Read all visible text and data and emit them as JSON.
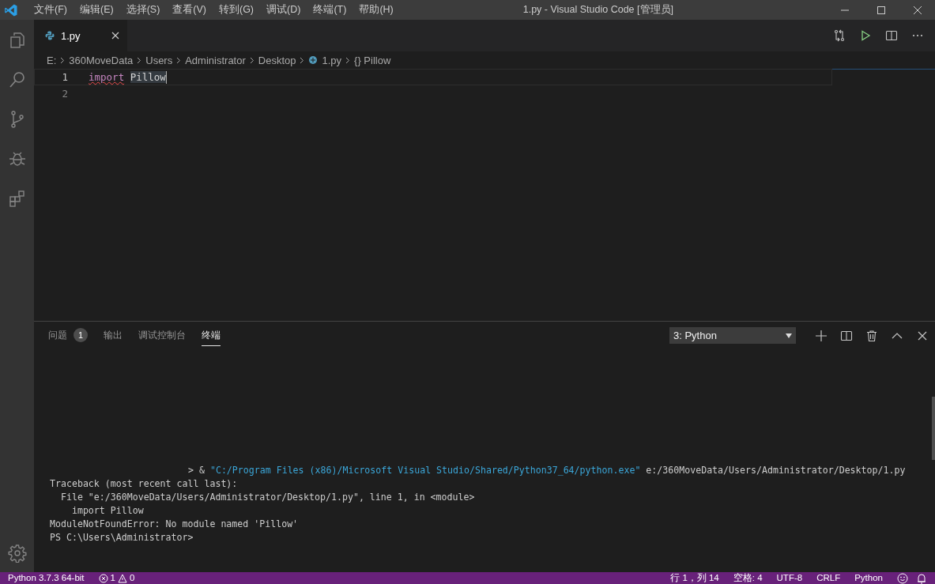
{
  "window": {
    "title": "1.py - Visual Studio Code [管理员]"
  },
  "menu": [
    "文件(F)",
    "编辑(E)",
    "选择(S)",
    "查看(V)",
    "转到(G)",
    "调试(D)",
    "终端(T)",
    "帮助(H)"
  ],
  "activity_bar": [
    {
      "kind": "files"
    },
    {
      "kind": "search"
    },
    {
      "kind": "source-control"
    },
    {
      "kind": "debug"
    },
    {
      "kind": "extensions"
    }
  ],
  "tabs": [
    {
      "label": "1.py",
      "selected": true
    }
  ],
  "breadcrumb": [
    {
      "label": "E:",
      "kind": "folder"
    },
    {
      "label": "360MoveData",
      "kind": "folder"
    },
    {
      "label": "Users",
      "kind": "folder"
    },
    {
      "label": "Administrator",
      "kind": "folder"
    },
    {
      "label": "Desktop",
      "kind": "folder"
    },
    {
      "label": "1.py",
      "kind": "file"
    },
    {
      "label": "{} Pillow",
      "kind": "symbol"
    }
  ],
  "editor": {
    "lines": [
      {
        "number": "1",
        "current": true,
        "tokens": [
          {
            "text": "import",
            "kind": "keyword",
            "error": true
          },
          {
            "text": "Pillow",
            "kind": "highlighted",
            "error": false
          }
        ]
      },
      {
        "number": "2",
        "current": false
      }
    ]
  },
  "panel": {
    "tabs": [
      {
        "label": "问题",
        "badge": "1",
        "selected": false
      },
      {
        "label": "输出",
        "selected": false
      },
      {
        "label": "调试控制台",
        "selected": false
      },
      {
        "label": "终端",
        "selected": true
      }
    ],
    "terminal_select": "3: Python",
    "terminal": [
      {
        "kind": "command",
        "parts": [
          {
            "text": "> & ",
            "kind": "plain"
          },
          {
            "text": "\"C:/Program Files (x86)/Microsoft Visual Studio/Shared/Python37_64/python.exe\"",
            "kind": "string"
          },
          {
            "text": " e:/360MoveData/Users/Administrator/Desktop/1.py",
            "kind": "plain"
          }
        ]
      },
      {
        "kind": "output",
        "parts": [
          {
            "text": "Traceback (most recent call last):",
            "kind": "plain"
          }
        ]
      },
      {
        "kind": "output",
        "parts": [
          {
            "text": "  File \"e:/360MoveData/Users/Administrator/Desktop/1.py\", line 1, in <module>",
            "kind": "plain"
          }
        ]
      },
      {
        "kind": "output",
        "parts": [
          {
            "text": "    import Pillow",
            "kind": "plain"
          }
        ]
      },
      {
        "kind": "output",
        "parts": [
          {
            "text": "ModuleNotFoundError: No module named 'Pillow'",
            "kind": "plain"
          }
        ]
      },
      {
        "kind": "output",
        "parts": [
          {
            "text": "PS C:\\Users\\Administrator>",
            "kind": "plain"
          }
        ]
      }
    ]
  },
  "status_bar": {
    "interpreter": "Python 3.7.3 64-bit",
    "errors": "1",
    "warnings": "0",
    "right": [
      "行 1，列 14",
      "空格: 4",
      "UTF-8",
      "CRLF",
      "Python"
    ]
  }
}
